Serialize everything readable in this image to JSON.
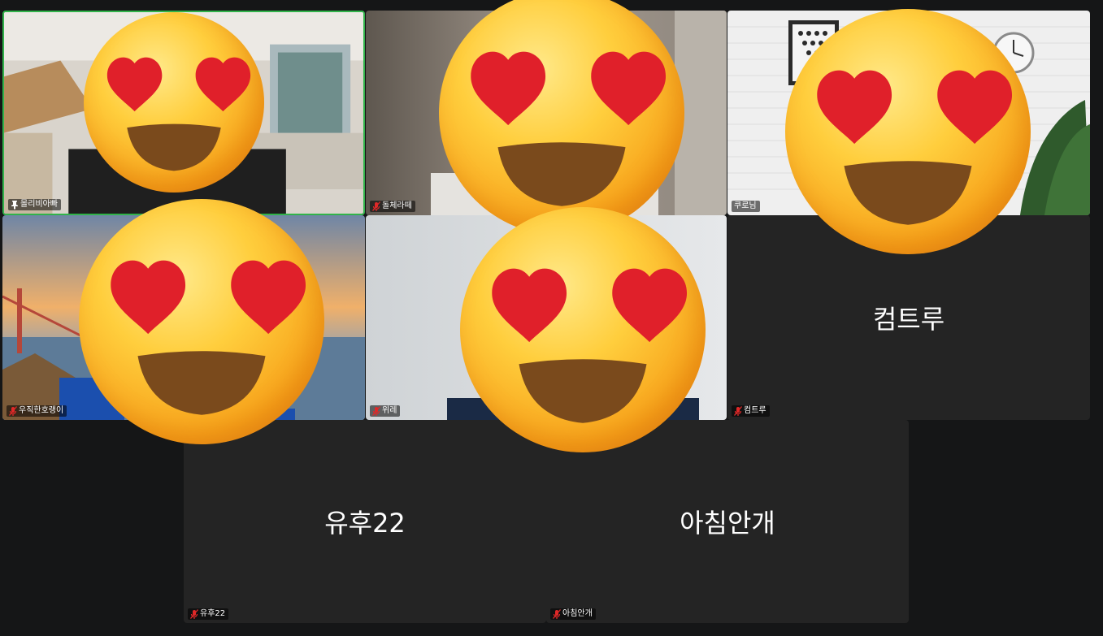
{
  "participants": [
    {
      "id": "p1",
      "name": "몰리비아빠",
      "status_icon": "pin-icon",
      "video": true,
      "active_speaker": true,
      "scene": "living-room"
    },
    {
      "id": "p2",
      "name": "돌체라떼",
      "status_icon": "muted-mic-icon",
      "video": true,
      "scene": "blur-room"
    },
    {
      "id": "p3",
      "name": "쿠로님",
      "status_icon": "none",
      "video": true,
      "scene": "brick-wall"
    },
    {
      "id": "p4",
      "name": "우직한호랭이",
      "status_icon": "muted-mic-icon",
      "video": true,
      "scene": "golden-gate"
    },
    {
      "id": "p5",
      "name": "위레",
      "status_icon": "muted-mic-icon",
      "video": true,
      "scene": "plain-wall"
    },
    {
      "id": "p6",
      "name": "컴트루",
      "status_icon": "muted-mic-icon",
      "video": false
    },
    {
      "id": "p7",
      "name": "유후22",
      "status_icon": "muted-mic-icon",
      "video": false
    },
    {
      "id": "p8",
      "name": "아침안개",
      "status_icon": "muted-mic-icon",
      "video": false
    }
  ],
  "overlays": {
    "emoji": "heart-eyes-emoji-icon",
    "count": 5
  },
  "colors": {
    "background": "#151617",
    "tile": "#242424",
    "active_border": "#31b34a",
    "muted_icon": "#e02828",
    "emoji_heart": "#e0202a"
  }
}
